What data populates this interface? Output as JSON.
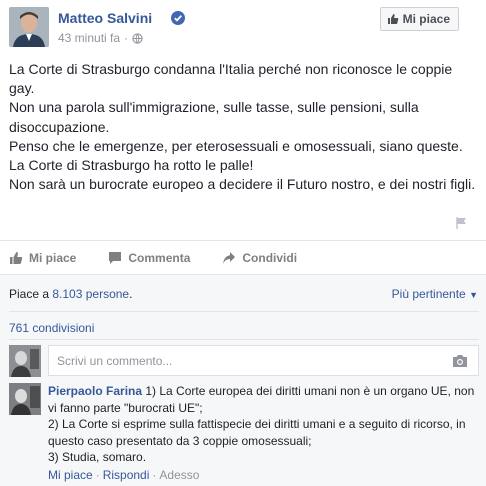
{
  "post": {
    "author": "Matteo Salvini",
    "timestamp": "43 minuti fa",
    "like_page_label": "Mi piace",
    "body": [
      "La Corte di Strasburgo condanna l'Italia perché non riconosce le coppie gay.",
      "Non una parola sull'immigrazione, sulle tasse, sulle pensioni, sulla disoccupazione.",
      "Penso che le emergenze, per eterosessuali e omosessuali, siano queste.",
      "La Corte di Strasburgo ha rotto le palle!",
      "Non sarà un burocrate europeo a decidere il Futuro nostro, e dei nostri figli."
    ]
  },
  "actions": {
    "like": "Mi piace",
    "comment": "Commenta",
    "share": "Condividi"
  },
  "feedback": {
    "likes_prefix": "Piace a ",
    "likes_count": "8.103 persone",
    "likes_suffix": ".",
    "sort_label": "Più pertinente",
    "shares": "761 condivisioni",
    "comment_placeholder": "Scrivi un commento..."
  },
  "comments": [
    {
      "author": "Pierpaolo Farina",
      "lines": [
        "1) La Corte europea dei diritti umani non è un organo UE, non vi fanno parte \"burocrati UE\";",
        "2) La Corte si esprime sulla fattispecie dei diritti umani e a seguito di ricorso, in questo caso presentato da 3 coppie omosessuali;",
        "3) Studia, somaro."
      ],
      "like_label": "Mi piace",
      "reply_label": "Rispondi",
      "time_label": "Adesso"
    }
  ],
  "colors": {
    "link": "#365899",
    "muted": "#90949c",
    "verified": "#4267b2"
  },
  "icons": [
    "verified-badge-icon",
    "globe-icon",
    "thumbs-up-icon",
    "comment-icon",
    "share-icon",
    "flag-icon",
    "camera-icon",
    "chevron-down-icon"
  ]
}
